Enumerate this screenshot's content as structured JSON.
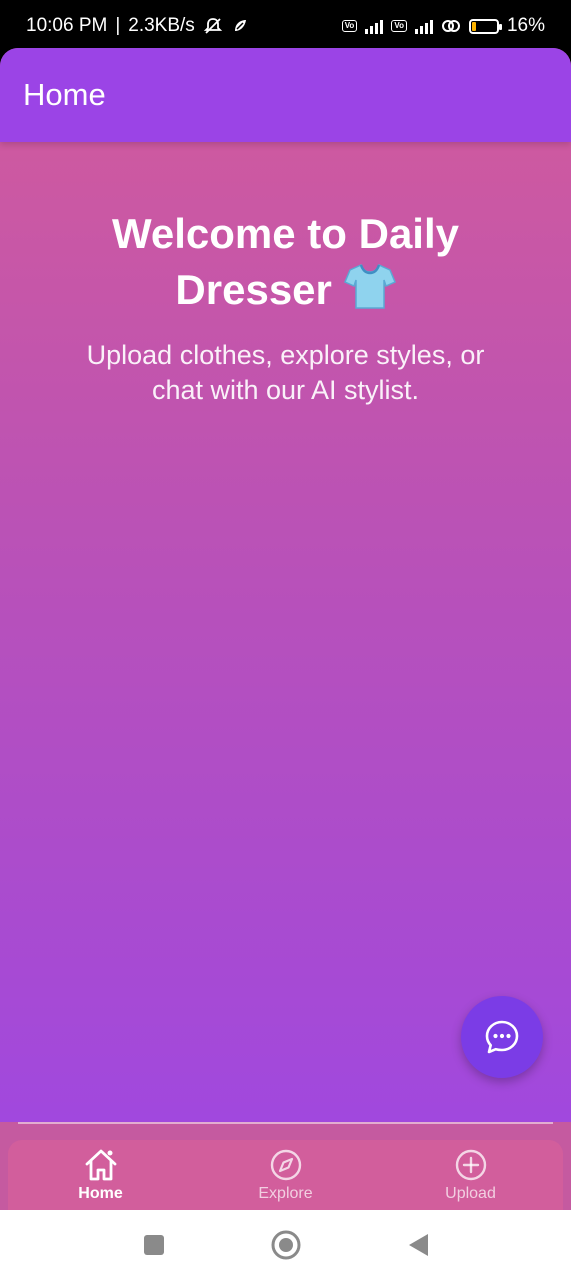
{
  "status_bar": {
    "time": "10:06 PM",
    "separator": "|",
    "network_speed": "2.3KB/s",
    "battery_percent": "16%",
    "battery_level": 0.16,
    "icons": [
      "mute-icon",
      "sync-icon",
      "volte-icon",
      "5g-signal-icon",
      "volte-icon",
      "signal-icon",
      "hotspot-icon",
      "battery-icon"
    ]
  },
  "app_bar": {
    "title": "Home"
  },
  "hero": {
    "title": "Welcome to Daily Dresser",
    "title_icon": "t-shirt-emoji",
    "subtitle": "Upload clothes, explore styles, or chat with our AI stylist."
  },
  "fab": {
    "icon": "chat-bubble-icon"
  },
  "bottom_nav": {
    "items": [
      {
        "label": "Home",
        "icon": "home-icon",
        "active": true
      },
      {
        "label": "Explore",
        "icon": "compass-icon",
        "active": false
      },
      {
        "label": "Upload",
        "icon": "plus-circle-icon",
        "active": false
      }
    ]
  },
  "system_nav": {
    "icons": [
      "recents-square-icon",
      "home-circle-icon",
      "back-triangle-icon"
    ]
  },
  "colors": {
    "app_bar": "#9b44e6",
    "gradient_top": "#d25b9b",
    "gradient_bottom": "#9d47e4",
    "fab": "#7b3ce6",
    "bottom_nav": "#d25e9c"
  }
}
